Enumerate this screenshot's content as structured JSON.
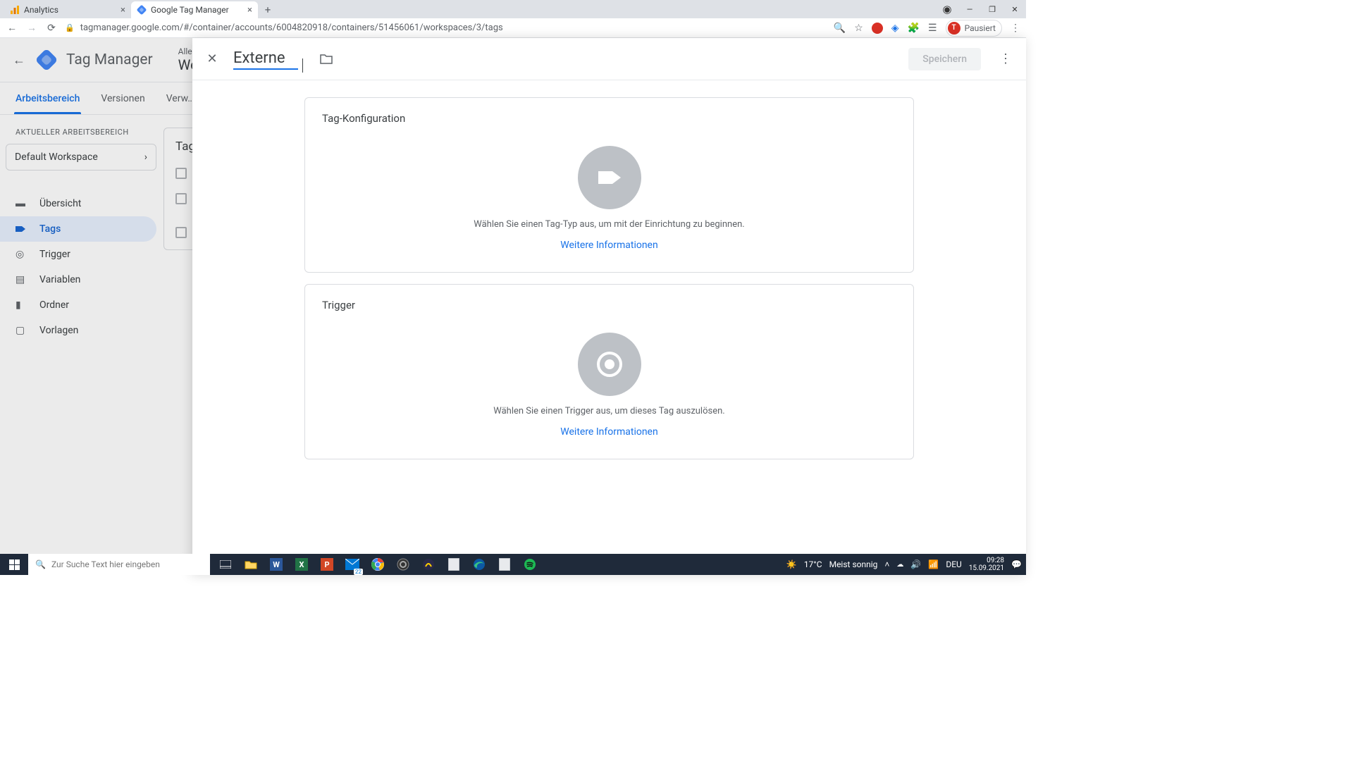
{
  "browser": {
    "tabs": [
      {
        "title": "Analytics",
        "active": false
      },
      {
        "title": "Google Tag Manager",
        "active": true
      }
    ],
    "url": "tagmanager.google.com/#/container/accounts/6004820918/containers/51456061/workspaces/3/tags",
    "profile": {
      "initial": "T",
      "status": "Pausiert"
    }
  },
  "gtm": {
    "app_title": "Tag Manager",
    "breadcrumb": "Alle K…",
    "container": "We…",
    "tabs": {
      "workspace": "Arbeitsbereich",
      "versions": "Versionen",
      "admin": "Verw…"
    },
    "workspace_label": "AKTUELLER ARBEITSBEREICH",
    "workspace_name": "Default Workspace",
    "sidebar": {
      "overview": "Übersicht",
      "tags": "Tags",
      "trigger": "Trigger",
      "variables": "Variablen",
      "folders": "Ordner",
      "templates": "Vorlagen"
    },
    "content_heading": "Tag"
  },
  "modal": {
    "name_value": "Externe",
    "save_label": "Speichern",
    "tag_config": {
      "title": "Tag-Konfiguration",
      "hint": "Wählen Sie einen Tag-Typ aus, um mit der Einrichtung zu beginnen.",
      "link": "Weitere Informationen"
    },
    "trigger": {
      "title": "Trigger",
      "hint": "Wählen Sie einen Trigger aus, um dieses Tag auszulösen.",
      "link": "Weitere Informationen"
    }
  },
  "taskbar": {
    "search_placeholder": "Zur Suche Text hier eingeben",
    "weather_temp": "17°C",
    "weather_desc": "Meist sonnig",
    "lang": "DEU",
    "time": "09:28",
    "date": "15.09.2021",
    "calendar_badge": "22"
  }
}
